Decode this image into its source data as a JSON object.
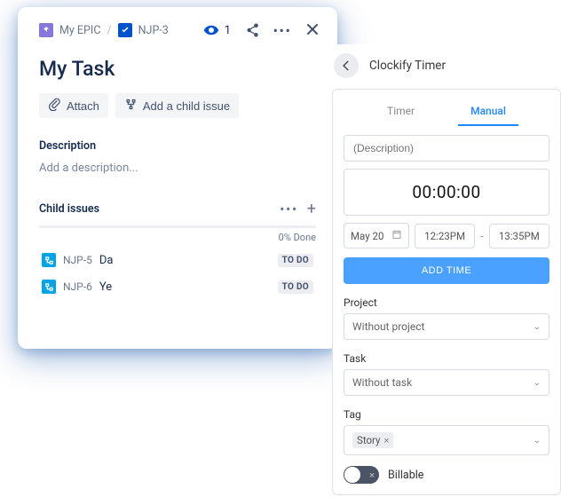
{
  "breadcrumb": {
    "epic": "My EPIC",
    "separator": "/",
    "key": "NJP-3"
  },
  "watchers": "1",
  "title": "My Task",
  "actions": {
    "attach": "Attach",
    "addChild": "Add a child issue"
  },
  "descLabel": "Description",
  "descPlaceholder": "Add a description...",
  "childHeader": "Child issues",
  "progressPct": "0% Done",
  "children": [
    {
      "key": "NJP-5",
      "summary": "Da",
      "status": "TO DO"
    },
    {
      "key": "NJP-6",
      "summary": "Ye",
      "status": "TO DO"
    }
  ],
  "clockify": {
    "title": "Clockify Timer",
    "tabs": {
      "timer": "Timer",
      "manual": "Manual"
    },
    "descPlaceholder": "(Description)",
    "timeValue": "00:00:00",
    "date": "May 20",
    "startTime": "12:23PM",
    "endTime": "13:35PM",
    "addTime": "ADD TIME",
    "projectLabel": "Project",
    "projectValue": "Without project",
    "taskLabel": "Task",
    "taskValue": "Without task",
    "tagLabel": "Tag",
    "tagValue": "Story",
    "billableLabel": "Billable"
  }
}
